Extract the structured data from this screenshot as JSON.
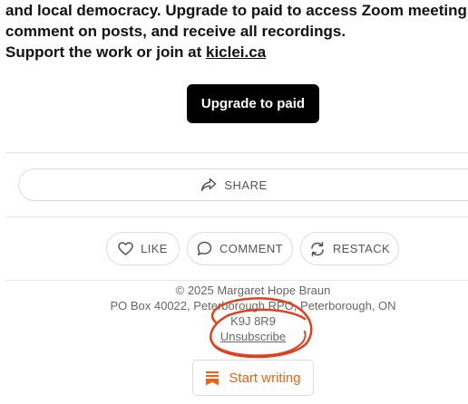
{
  "intro": {
    "line1": "and local democracy. Upgrade to paid to access Zoom meetings,",
    "line2": "comment on posts, and receive all recordings.",
    "line3_prefix": "Support the work or join at ",
    "link": "kiclei.ca"
  },
  "upgrade": {
    "label": "Upgrade to paid"
  },
  "share": {
    "label": "SHARE",
    "icon": "share-arrow-icon"
  },
  "actions": {
    "like": {
      "label": "LIKE",
      "icon": "heart-icon"
    },
    "comment": {
      "label": "COMMENT",
      "icon": "speech-bubble-icon"
    },
    "restack": {
      "label": "RESTACK",
      "icon": "restack-icon"
    }
  },
  "footer": {
    "copyright": "© 2025 Margaret Hope Braun",
    "address": "PO Box 40022, Peterborough RPO, Peterborough, ON",
    "postal": "K9J 8R9",
    "unsubscribe": "Unsubscribe"
  },
  "start_writing": {
    "label": "Start writing",
    "icon": "bookmark-stack-icon"
  },
  "colors": {
    "accent": "#e8641b",
    "annotation": "#e0401c",
    "button_bg": "#000000"
  }
}
